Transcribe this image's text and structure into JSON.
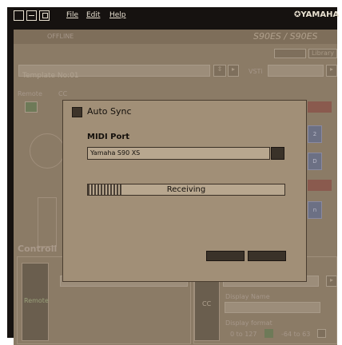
{
  "titlebar": {
    "menus": [
      "File",
      "Edit",
      "Help"
    ],
    "brand": "YAMAHA"
  },
  "background": {
    "status": "OFFLINE",
    "logo": "S90ES / S90ES",
    "library_label": "Library",
    "template_label": "Template No:01",
    "vsti_label": "VSTi",
    "remote_label": "Remote",
    "cc_label": "CC",
    "side_labels": [
      "2",
      "D",
      "n"
    ],
    "controller_label": "Controll",
    "remote_box": "Remote",
    "cc_box": "CC",
    "display_name_label": "Display Name",
    "display_format_label": "Display format",
    "format_option_1": "0 to 127",
    "format_option_2": "-64 to 63"
  },
  "dialog": {
    "auto_sync_label": "Auto Sync",
    "auto_sync_checked": false,
    "midi_port_label": "MIDI Port",
    "midi_port_value": "Yamaha S90 XS",
    "progress_text": "Receiving",
    "progress_fraction": 0.17
  },
  "colors": {
    "dialog_bg": "#a18f77",
    "app_bg": "#8b7b66",
    "frame": "#161210"
  }
}
